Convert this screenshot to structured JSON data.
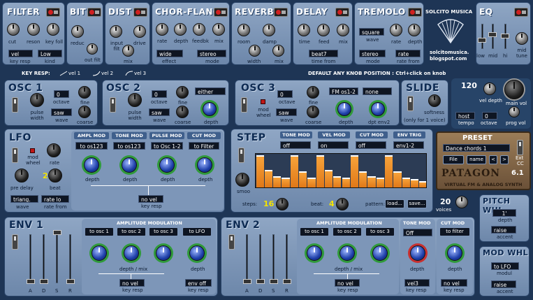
{
  "filter": {
    "title": "FILTER",
    "knobs": [
      "cut",
      "reson",
      "key foll"
    ],
    "vel": "vel",
    "low": "Low",
    "vel_label": "key resp",
    "low_label": "kind"
  },
  "bit": {
    "title": "BIT",
    "knobs": [
      "reduc",
      "out filt"
    ]
  },
  "dist": {
    "title": "DIST",
    "knobs": [
      "input filt",
      "drive",
      "mix"
    ]
  },
  "chorus": {
    "title": "CHOR-FLANG",
    "knobs": [
      "rate",
      "depth",
      "feedbk",
      "mix"
    ],
    "wide": "wide",
    "stereo": "stereo",
    "effect": "effect",
    "mode": "mode"
  },
  "reverb": {
    "title": "REVERB",
    "knobs": [
      "room",
      "damp",
      "width",
      "mix"
    ]
  },
  "delay": {
    "title": "DELAY",
    "knobs": [
      "time",
      "feed",
      "mix"
    ],
    "beat": "beat7",
    "time_from": "time from"
  },
  "tremolo": {
    "title": "TREMOLO",
    "wave_dd": "square",
    "wave": "wave",
    "knobs": [
      "rate",
      "depth"
    ],
    "mode_dd": "stereo",
    "mode": "mode",
    "rate_dd": "rate",
    "rate_from": "rate from"
  },
  "brand": {
    "name": "SOLCITO MUSICA",
    "url1": "solcitomusica.",
    "url2": "blogspot.com"
  },
  "eq": {
    "title": "EQ",
    "labels": [
      "low",
      "mid",
      "hi",
      "mid tune"
    ]
  },
  "keyresp": {
    "label": "KEY RESP:",
    "vel1": "vel 1",
    "vel2": "vel 2",
    "vel3": "vel 3",
    "hint": "DEFAULT ANY KNOB POSITION : Ctrl+click on knob"
  },
  "osc1": {
    "title": "OSC 1",
    "octave": "0",
    "saw": "saw",
    "pulse_width": "pulse width",
    "octave_l": "octave",
    "wave_l": "wave",
    "fine": "fine",
    "coarse": "coarse"
  },
  "osc2": {
    "title": "OSC 2",
    "octave": "0",
    "saw": "saw",
    "either": "either",
    "pulse_width": "pulse width",
    "octave_l": "octave",
    "wave_l": "wave",
    "fine": "fine",
    "coarse": "coarse",
    "depth": "depth"
  },
  "osc3": {
    "title": "OSC 3",
    "octave": "0",
    "saw": "saw",
    "fm": "FM os1-2",
    "none": "none",
    "mod_wheel": "mod wheel",
    "octave_l": "octave",
    "wave_l": "wave",
    "fine": "fine",
    "coarse": "coarse",
    "depth": "depth",
    "dpt_env2": "dpt env2"
  },
  "slide": {
    "title": "SLIDE",
    "softness": "softness",
    "only": "(only for 1 voice)"
  },
  "master": {
    "tempo_val": "120",
    "host": "host",
    "tempo": "tempo",
    "vel_depth": "vel depth",
    "main_vol": "main vol",
    "octave_val": "0",
    "octave": "octave",
    "prog_vol": "prog vol"
  },
  "lfo": {
    "title": "LFO",
    "mod_wheel": "mod wheel",
    "rate": "rate",
    "pre_delay": "pre delay",
    "beat_val": "2",
    "beat": "beat",
    "wave_dd": "triang.",
    "wave": "wave",
    "rate_dd": "rate lo",
    "rate_from": "rate from",
    "ampl_mod": "AMPL MOD",
    "tone_mod": "TONE MOD",
    "pulse_mod": "PULSE MOD",
    "cut_mod": "CUT MOD",
    "to_os123a": "to os123",
    "to_os123b": "to os123",
    "to_osc12": "to Osc 1-2",
    "to_filter": "to Filter",
    "depth": "depth",
    "novel": "no vel",
    "key_resp": "key resp"
  },
  "step": {
    "title": "STEP",
    "tone_mod": "TONE MOD",
    "vel_mod": "VEL MOD",
    "cut_mod": "CUT MOD",
    "env_trig": "ENV TRIG",
    "tone_dd": "off",
    "vel_dd": "on",
    "cut_dd": "off",
    "env_dd": "env1-2",
    "smoo": "smoo",
    "steps_l": "steps:",
    "steps_val": "16",
    "beat_l": "beat:",
    "beat_val": "4",
    "pattern": "pattern:",
    "load": "load...",
    "save": "save...",
    "bars": [
      1,
      0.55,
      0.35,
      0.3,
      1,
      0.5,
      0.3,
      1,
      0.55,
      0.35,
      0.3,
      1,
      0.5,
      0.35,
      0.3,
      1,
      0.5,
      0.3,
      0.25,
      0.2
    ]
  },
  "preset": {
    "title": "PRESET",
    "name": "Dance chords 1",
    "file": "File",
    "namebtn": "name",
    "prev": "<",
    "next": ">",
    "ext": "Ext",
    "cc": "CC",
    "logo": "PATAGON",
    "ver": "6.1",
    "sub": "VIRTUAL FM & ANALOG SYNTH"
  },
  "voices": {
    "val": "20",
    "label": "voices"
  },
  "pitch": {
    "title": "PITCH WHL",
    "dd": "1'",
    "depth": "depth",
    "raise": "raise",
    "accent": "accent"
  },
  "modwhl": {
    "title": "MOD WHL",
    "dd": "to LFO",
    "modul": "modul",
    "raise": "raise",
    "accent": "accent"
  },
  "env1": {
    "title": "ENV 1",
    "amp": "AMPLITUDE  MODULATION",
    "b1": "to osc 1",
    "b2": "to osc 2",
    "b3": "to osc 3",
    "b4": "to LFO",
    "depth_mix": "depth / mix",
    "depth": "depth",
    "novel": "no vel",
    "envoff": "env off",
    "keyresp": "key resp",
    "adsr": [
      "A",
      "D",
      "S",
      "R"
    ]
  },
  "env2": {
    "title": "ENV 2",
    "amp": "AMPLITUDE  MODULATION",
    "b1": "to osc 1",
    "b2": "to osc 2",
    "b3": "to osc 3",
    "tone_mod": "TONE MOD",
    "cut_mod": "CUT MOD",
    "off": "Off",
    "tofilter": "to filter",
    "depth_mix": "depth / mix",
    "depth": "depth",
    "novel": "no vel",
    "vel3": "vel3",
    "novel2": "no vel",
    "keyresp": "key resp",
    "adsr": [
      "A",
      "D",
      "S",
      "R"
    ]
  }
}
